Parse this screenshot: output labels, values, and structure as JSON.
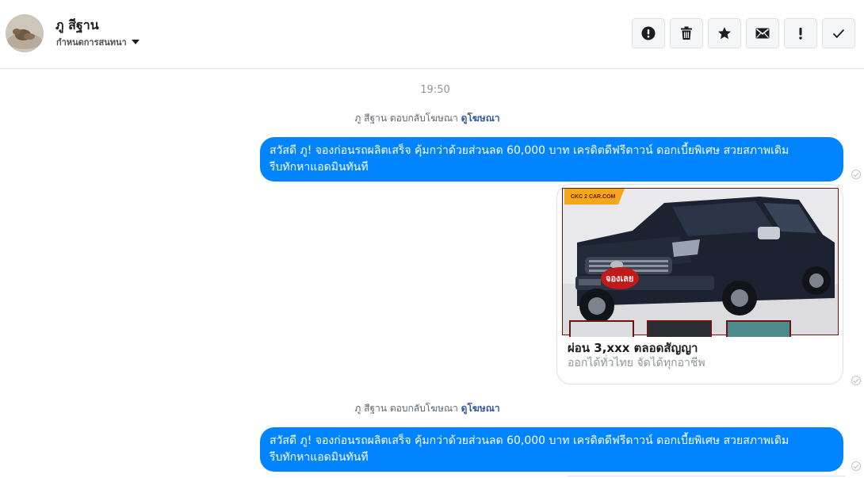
{
  "header": {
    "contact_name": "ภู สีฐาน",
    "conversation_settings_label": "กำหนดการสนทนา",
    "toolbar": [
      {
        "name": "report-spam",
        "icon": "alert-circle-icon"
      },
      {
        "name": "delete",
        "icon": "trash-icon"
      },
      {
        "name": "star",
        "icon": "star-icon"
      },
      {
        "name": "mark-unread",
        "icon": "envelope-icon"
      },
      {
        "name": "mark-important",
        "icon": "exclamation-icon"
      },
      {
        "name": "mark-done",
        "icon": "checkmark-icon"
      }
    ]
  },
  "conversation": {
    "timestamp": "19:50",
    "reply_notes": [
      {
        "text": "ภู สีฐาน ตอบกลับโฆษณา",
        "link": "ดูโฆษณา"
      },
      {
        "text": "ภู สีฐาน ตอบกลับโฆษณา",
        "link": "ดูโฆษณา"
      }
    ],
    "messages": [
      {
        "text": "สวัสดี ภู! จองก่อนรถผลิตเสร็จ คุ้มกว่าด้วยส่วนลด 60,000 บาท เครดิตดีฟรีดาวน์ ดอกเบี้ยพิเศษ สวยสภาพเดิม\nรีบทักหาแอดมินทันที"
      },
      {
        "text": "สวัสดี ภู! จองก่อนรถผลิตเสร็จ คุ้มกว่าด้วยส่วนลด 60,000 บาท เครดิตดีฟรีดาวน์ ดอกเบี้ยพิเศษ สวยสภาพเดิม\nรีบทักหาแอดมินทันที"
      }
    ],
    "ad_card": {
      "image_logo_text": "CKC 2 CAR.COM",
      "image_badge_text": "จองเลย",
      "title": "ผ่อน 3,xxx ตลอดสัญญา",
      "subtitle": "ออกได้ทั่วไทย จัดได้ทุกอาชีพ"
    }
  },
  "colors": {
    "bubble": "#0084ff",
    "link": "#385898",
    "meta_text": "#90949c"
  }
}
